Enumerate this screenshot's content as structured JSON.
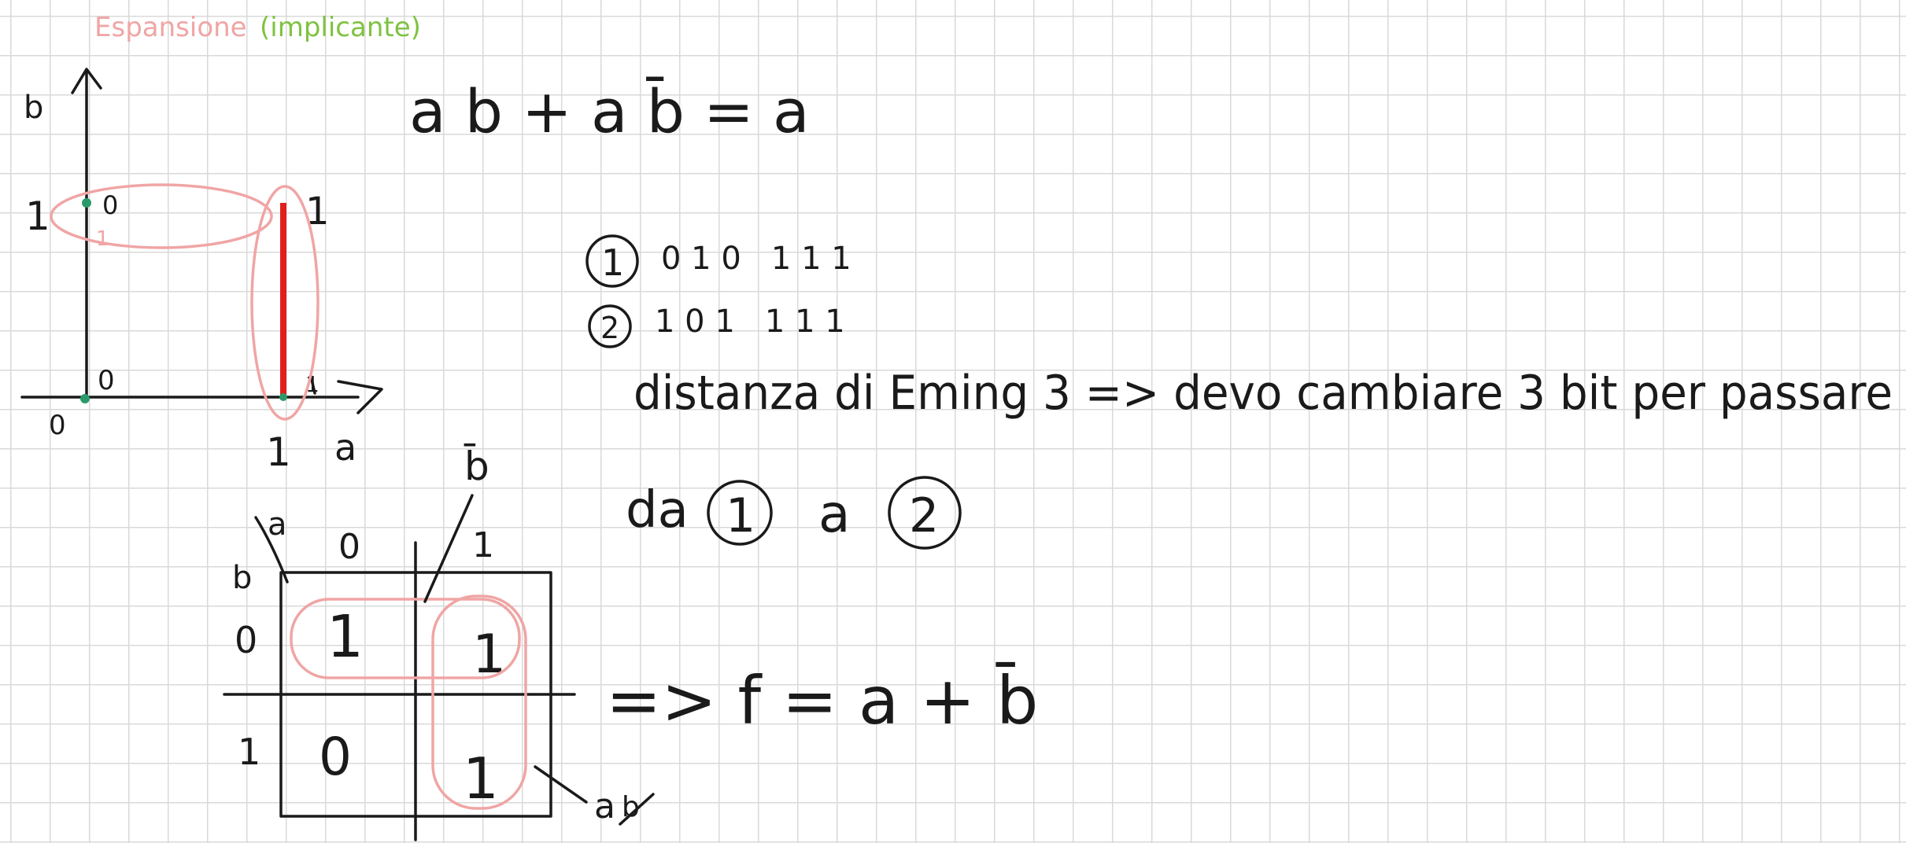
{
  "title": {
    "word": "Espansione",
    "paren": "(implicante)"
  },
  "colors": {
    "ink": "#1a1a1a",
    "pink": "#f0a5a5",
    "green": "#7fc241",
    "red": "#e0201c",
    "dot": "#2a9a6a"
  },
  "graph": {
    "axis_b": "b",
    "axis_a": "a",
    "origin": "0",
    "tick_x1": "1",
    "tick_y1": "1",
    "pt_00": "0",
    "pt_01": "0",
    "pt_01_under": "1",
    "pt_11": "1",
    "pt_10": "1"
  },
  "equation": "a b + a b̄ = a",
  "codes": [
    {
      "num": "1",
      "bits": "0 1 0   1 1 1"
    },
    {
      "num": "2",
      "bits": "1 0 1   1 1 1"
    }
  ],
  "distance_text": "distanza di Eming 3 => devo cambiare 3 bit per passare",
  "from_text": {
    "da": "da",
    "n1": "1",
    "a": "a",
    "n2": "2"
  },
  "kmap": {
    "var_a": "a",
    "var_b": "b",
    "col0": "0",
    "col1": "1",
    "row0": "0",
    "row1": "1",
    "cells": [
      "1",
      "1",
      "0",
      "1"
    ],
    "label_bbar": "b̄",
    "label_a": "a"
  },
  "result": "=> f = a + b̄"
}
